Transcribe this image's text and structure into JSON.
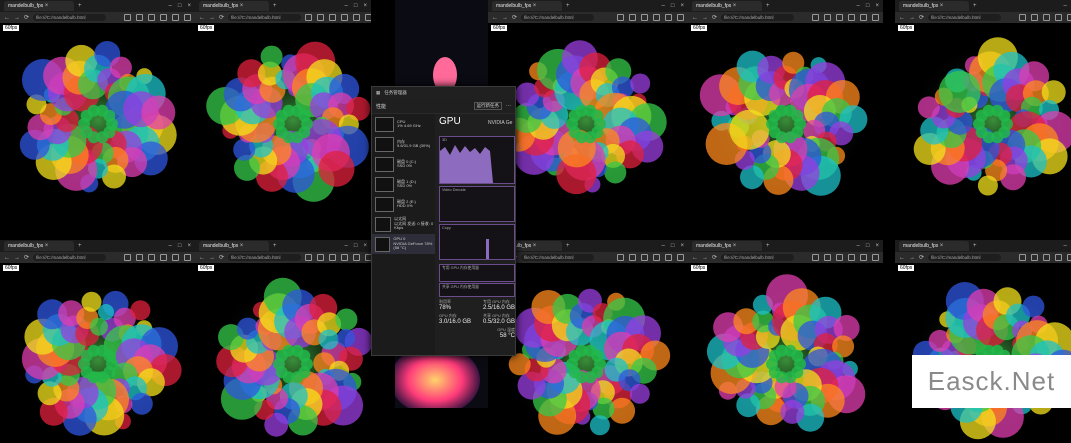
{
  "browser": {
    "tab_title": "mandelbulb_fps",
    "url": "file:///C:/mandelbulb.html",
    "tab_close": "×",
    "tab_new": "+",
    "controls": [
      "–",
      "□",
      "×"
    ],
    "nav": [
      "←",
      "→",
      "⟳"
    ],
    "page_label": "60fps"
  },
  "taskmgr": {
    "title": "任务管理器",
    "section": "性能",
    "run_task": "运行新任务",
    "sidebar": [
      {
        "name": "CPU",
        "detail": "1% 4.69 GHz"
      },
      {
        "name": "内存",
        "detail": "9.6/31.9 GB (30%)"
      },
      {
        "name": "磁盘 0 (C:)",
        "detail": "SSD 0%"
      },
      {
        "name": "磁盘 1 (D:)",
        "detail": "SSD 0%"
      },
      {
        "name": "磁盘 2 (E:)",
        "detail": "HDD 0%"
      },
      {
        "name": "以太网",
        "detail": "以太网 发送: 0 接收: 0 Kbps"
      },
      {
        "name": "GPU 0",
        "detail": "NVIDIA GeForce 78% (58 °C)"
      }
    ],
    "gpu_title": "GPU",
    "gpu_name": "NVIDIA Ge",
    "graph_labels": {
      "g1": "3D",
      "g2": "Video Decode",
      "g3": "Copy",
      "g4": "专用 GPU 内存使用量",
      "g5": "共享 GPU 内存使用量"
    },
    "stats": {
      "util_label": "利用率",
      "util_val": "78%",
      "ded_label": "专用 GPU 内存",
      "ded_val": "2.5/16.0 GB",
      "gpu_mem_label": "GPU 内存",
      "gpu_mem_val": "3.0/16.0 GB",
      "shared_label": "共享 GPU 内存",
      "shared_val": "0.5/32.0 GB",
      "temp_label": "GPU 温度",
      "temp_val": "58 °C"
    }
  },
  "watermark": "Easck.Net"
}
